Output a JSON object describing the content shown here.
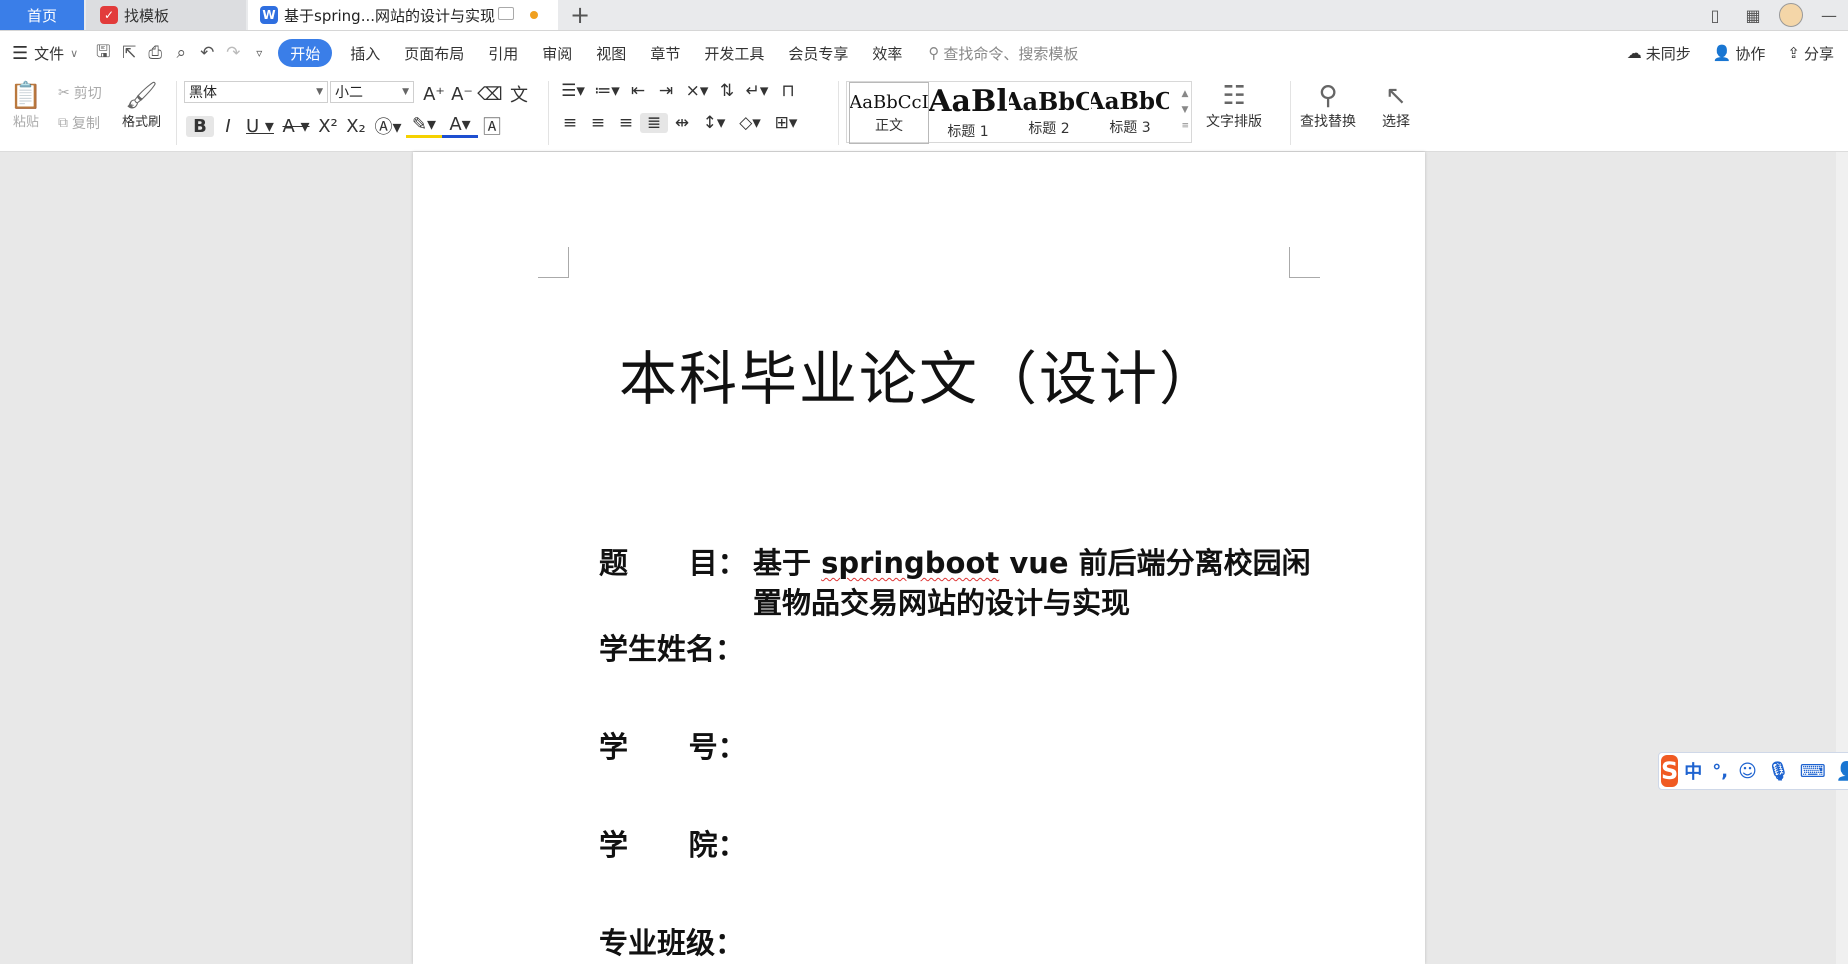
{
  "tabs": {
    "home": "首页",
    "template": "找模板",
    "document": "基于spring...网站的设计与实现",
    "add": "+"
  },
  "menu": {
    "file": "文件",
    "items": [
      "开始",
      "插入",
      "页面布局",
      "引用",
      "审阅",
      "视图",
      "章节",
      "开发工具",
      "会员专享",
      "效率"
    ],
    "search_placeholder": "查找命令、搜索模板",
    "sync": "未同步",
    "collab": "协作",
    "share": "分享"
  },
  "ribbon": {
    "paste": "粘贴",
    "cut": "剪切",
    "copy": "复制",
    "format_painter": "格式刷",
    "font_name": "黑体",
    "font_size": "小二",
    "styles": [
      {
        "sample": "AaBbCcI",
        "name": "正文"
      },
      {
        "sample": "AaBl",
        "name": "标题 1"
      },
      {
        "sample": "AaBbC",
        "name": "标题 2"
      },
      {
        "sample": "AaBbC",
        "name": "标题 3"
      }
    ],
    "text_layout": "文字排版",
    "find_replace": "查找替换",
    "select": "选择"
  },
  "document": {
    "title": "本科毕业论文（设计）",
    "fields": [
      {
        "label": "题      目：",
        "value_pre": "基于 ",
        "value_spell": "springboot",
        "value_mid": " vue 前后端分离校园闲",
        "value_line2": "置物品交易网站的设计与实现"
      },
      {
        "label": "学生姓名："
      },
      {
        "label": "学      号："
      },
      {
        "label": "学      院："
      },
      {
        "label": "专业班级："
      }
    ]
  },
  "ime": {
    "mode": "中",
    "punct": "°,"
  },
  "colors": {
    "accent": "#3a7ee8",
    "ime_logo": "#f05a22"
  }
}
